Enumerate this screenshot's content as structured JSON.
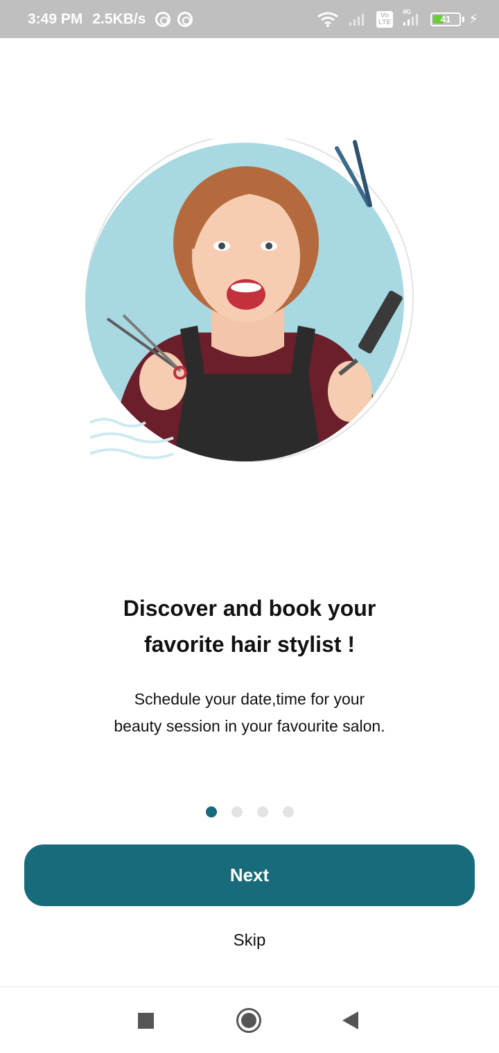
{
  "status_bar": {
    "time": "3:49 PM",
    "speed": "2.5KB/s",
    "network": "4G",
    "volte": "Vo LTE",
    "battery": "41",
    "battery_level": 0.41,
    "icons": [
      "sync-icon",
      "sync-icon",
      "wifi-icon",
      "signal-icon",
      "volte-icon",
      "signal-4g-icon",
      "battery-icon",
      "charging-bolt-icon"
    ]
  },
  "hero": {
    "icon": "hairstylist-illustration",
    "circle_color": "#a8d8e2"
  },
  "onboarding": {
    "title_line1": "Discover and book your",
    "title_line2": "favorite hair stylist !",
    "subtitle_line1": "Schedule your date,time for your",
    "subtitle_line2": "beauty session in your favourite salon.",
    "page_count": 4,
    "current_page": 1
  },
  "actions": {
    "next_label": "Next",
    "skip_label": "Skip"
  },
  "colors": {
    "accent": "#186b7a",
    "inactive_dot": "#e3e3e3"
  },
  "nav_bar": {
    "icons": [
      "recent-apps-icon",
      "home-icon",
      "back-icon"
    ]
  }
}
